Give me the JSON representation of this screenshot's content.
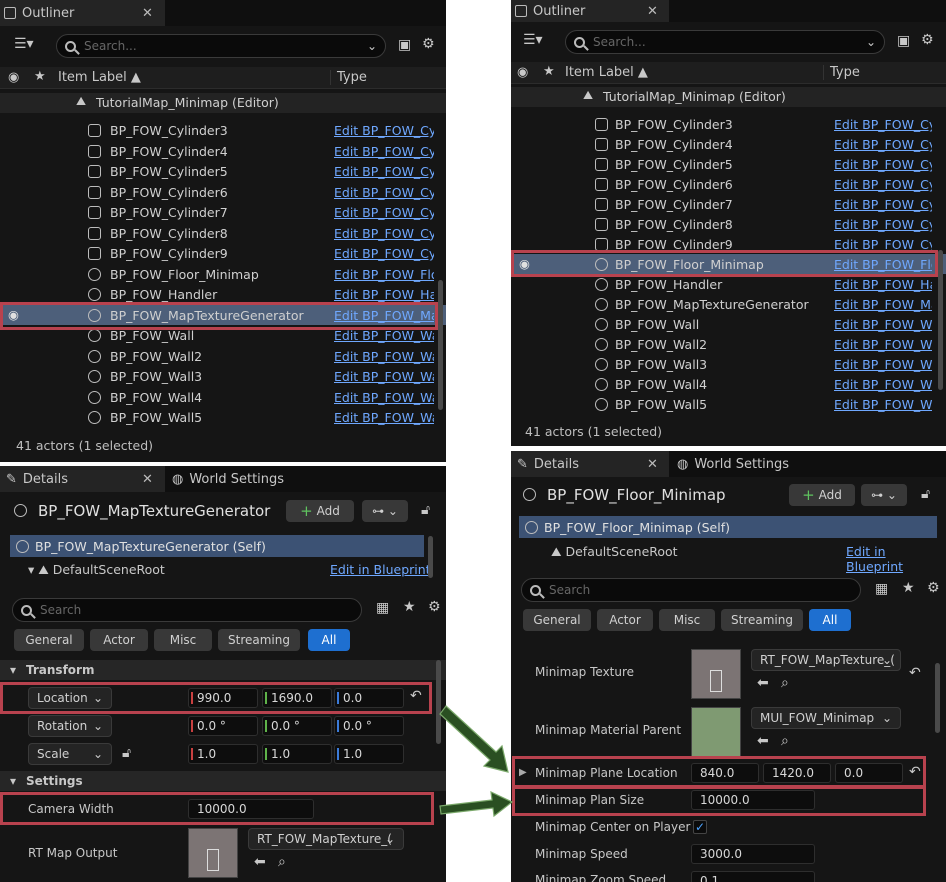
{
  "left": {
    "outliner": {
      "tab_label": "Outliner",
      "search_placeholder": "Search...",
      "col_item_label": "Item Label ▲",
      "col_type": "Type",
      "root_label": "TutorialMap_Minimap (Editor)",
      "rows": [
        {
          "label": "BP_FOW_Cylinder3",
          "type": "Edit BP_FOW_Cyl"
        },
        {
          "label": "BP_FOW_Cylinder4",
          "type": "Edit BP_FOW_Cyl"
        },
        {
          "label": "BP_FOW_Cylinder5",
          "type": "Edit BP_FOW_Cyl"
        },
        {
          "label": "BP_FOW_Cylinder6",
          "type": "Edit BP_FOW_Cyl"
        },
        {
          "label": "BP_FOW_Cylinder7",
          "type": "Edit BP_FOW_Cyl"
        },
        {
          "label": "BP_FOW_Cylinder8",
          "type": "Edit BP_FOW_Cyl"
        },
        {
          "label": "BP_FOW_Cylinder9",
          "type": "Edit BP_FOW_Cyl"
        },
        {
          "label": "BP_FOW_Floor_Minimap",
          "type": "Edit BP_FOW_Flo"
        },
        {
          "label": "BP_FOW_Handler",
          "type": "Edit BP_FOW_Ha"
        },
        {
          "label": "BP_FOW_MapTextureGenerator",
          "type": "Edit BP_FOW_Ma"
        },
        {
          "label": "BP_FOW_Wall",
          "type": "Edit BP_FOW_Wa"
        },
        {
          "label": "BP_FOW_Wall2",
          "type": "Edit BP_FOW_Wa"
        },
        {
          "label": "BP_FOW_Wall3",
          "type": "Edit BP_FOW_Wa"
        },
        {
          "label": "BP_FOW_Wall4",
          "type": "Edit BP_FOW_Wa"
        },
        {
          "label": "BP_FOW_Wall5",
          "type": "Edit BP_FOW_Wa"
        }
      ],
      "status": "41 actors (1 selected)"
    },
    "details": {
      "tab_label": "Details",
      "tab2_label": "World Settings",
      "actor_name": "BP_FOW_MapTextureGenerator",
      "add_label": "Add",
      "self_label": "BP_FOW_MapTextureGenerator (Self)",
      "scene_root": "DefaultSceneRoot",
      "edit_bp": "Edit in Blueprint",
      "search_placeholder": "Search",
      "filters": [
        "General",
        "Actor",
        "Misc",
        "Streaming",
        "All"
      ],
      "transform_title": "Transform",
      "location_label": "Location",
      "location": [
        "990.0",
        "1690.0",
        "0.0"
      ],
      "rotation_label": "Rotation",
      "rotation": [
        "0.0 °",
        "0.0 °",
        "0.0 °"
      ],
      "scale_label": "Scale",
      "scale": [
        "1.0",
        "1.0",
        "1.0"
      ],
      "settings_title": "Settings",
      "camera_width_label": "Camera Width",
      "camera_width": "10000.0",
      "rt_map_label": "RT Map Output",
      "rt_map_value": "RT_FOW_MapTexture_("
    }
  },
  "right": {
    "outliner": {
      "tab_label": "Outliner",
      "search_placeholder": "Search...",
      "col_item_label": "Item Label ▲",
      "col_type": "Type",
      "root_label": "TutorialMap_Minimap (Editor)",
      "rows": [
        {
          "label": "BP_FOW_Cylinder3",
          "type": "Edit BP_FOW_Cyl"
        },
        {
          "label": "BP_FOW_Cylinder4",
          "type": "Edit BP_FOW_Cyl"
        },
        {
          "label": "BP_FOW_Cylinder5",
          "type": "Edit BP_FOW_Cyl"
        },
        {
          "label": "BP_FOW_Cylinder6",
          "type": "Edit BP_FOW_Cyl"
        },
        {
          "label": "BP_FOW_Cylinder7",
          "type": "Edit BP_FOW_Cyl"
        },
        {
          "label": "BP_FOW_Cylinder8",
          "type": "Edit BP_FOW_Cyl"
        },
        {
          "label": "BP_FOW_Cylinder9",
          "type": "Edit BP_FOW_Cyl"
        },
        {
          "label": "BP_FOW_Floor_Minimap",
          "type": "Edit BP_FOW_Flo"
        },
        {
          "label": "BP_FOW_Handler",
          "type": "Edit BP_FOW_Ha"
        },
        {
          "label": "BP_FOW_MapTextureGenerator",
          "type": "Edit BP_FOW_Ma"
        },
        {
          "label": "BP_FOW_Wall",
          "type": "Edit BP_FOW_Wa"
        },
        {
          "label": "BP_FOW_Wall2",
          "type": "Edit BP_FOW_Wa"
        },
        {
          "label": "BP_FOW_Wall3",
          "type": "Edit BP_FOW_Wa"
        },
        {
          "label": "BP_FOW_Wall4",
          "type": "Edit BP_FOW_Wa"
        },
        {
          "label": "BP_FOW_Wall5",
          "type": "Edit BP_FOW_Wa"
        }
      ],
      "status": "41 actors (1 selected)"
    },
    "details": {
      "tab_label": "Details",
      "tab2_label": "World Settings",
      "actor_name": "BP_FOW_Floor_Minimap",
      "add_label": "Add",
      "self_label": "BP_FOW_Floor_Minimap (Self)",
      "scene_root": "DefaultSceneRoot",
      "edit_bp": "Edit in Blueprint",
      "search_placeholder": "Search",
      "filters": [
        "General",
        "Actor",
        "Misc",
        "Streaming",
        "All"
      ],
      "minimap_texture_label": "Minimap Texture",
      "minimap_texture_value": "RT_FOW_MapTexture_(",
      "minimap_material_label": "Minimap Material Parent",
      "minimap_material_value": "MUI_FOW_Minimap",
      "plane_location_label": "Minimap Plane Location",
      "plane_location": [
        "840.0",
        "1420.0",
        "0.0"
      ],
      "plan_size_label": "Minimap Plan Size",
      "plan_size": "10000.0",
      "center_player_label": "Minimap Center on Player",
      "speed_label": "Minimap Speed",
      "speed": "3000.0",
      "zoom_speed_label": "Minimap Zoom Speed",
      "zoom_speed": "0.1"
    }
  },
  "colors": {
    "highlight": "#b8424e",
    "accent": "#1e6fd0",
    "link": "#6fa8ff",
    "arrow": "#2f6b2a"
  }
}
